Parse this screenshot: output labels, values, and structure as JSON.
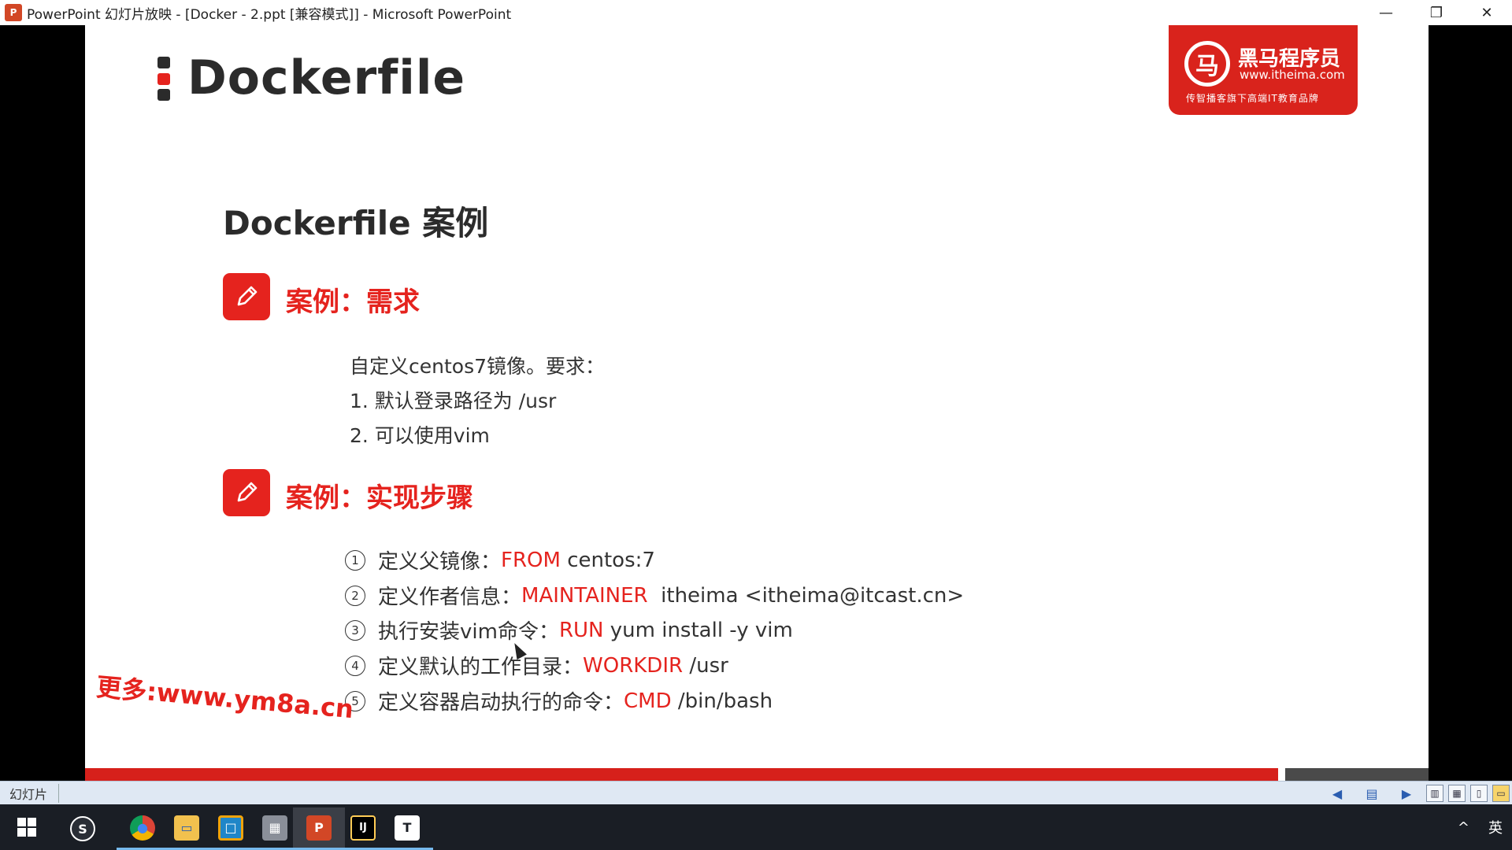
{
  "window": {
    "title": "PowerPoint 幻灯片放映 - [Docker - 2.ppt [兼容模式]] - Microsoft PowerPoint",
    "app_icon": "P",
    "minimize": "—",
    "restore": "❐",
    "close": "✕"
  },
  "slide": {
    "title": "Dockerfile",
    "logo": {
      "name": "黑马程序员",
      "url": "www.itheima.com",
      "slogan": "传智播客旗下高端IT教育品牌",
      "mark": "马"
    },
    "section_title": "Dockerfile 案例",
    "case1": {
      "title": "案例：需求",
      "lines": [
        "自定义centos7镜像。要求：",
        "1. 默认登录路径为 /usr",
        "2. 可以使用vim"
      ]
    },
    "case2": {
      "title": "案例：实现步骤",
      "steps": [
        {
          "num": "1",
          "text": "定义父镜像：",
          "keyword": "FROM",
          "rest": " centos:7"
        },
        {
          "num": "2",
          "text": "定义作者信息：",
          "keyword": "MAINTAINER",
          "rest": "  itheima <itheima@itcast.cn>"
        },
        {
          "num": "3",
          "text": "执行安装vim命令：",
          "keyword": "RUN",
          "rest": " yum install -y vim"
        },
        {
          "num": "4",
          "text": "定义默认的工作目录：",
          "keyword": "WORKDIR",
          "rest": " /usr"
        },
        {
          "num": "5",
          "text": "定义容器启动执行的命令：",
          "keyword": "CMD",
          "rest": " /bin/bash"
        }
      ]
    },
    "watermark": "更多:www.ym8a.cn",
    "colors": {
      "accent": "#e5231e",
      "marker_dark": "#2b2b2b",
      "marker_red": "#e5231e"
    }
  },
  "statusbar": {
    "label": "幻灯片",
    "prev_icon": "arrow-left-icon",
    "notes_icon": "notes-icon",
    "next_icon": "arrow-right-icon"
  },
  "taskbar": {
    "apps": [
      {
        "name": "360-browser",
        "glyph": "S"
      },
      {
        "name": "chrome",
        "glyph": "●"
      },
      {
        "name": "file-explorer",
        "glyph": "▭"
      },
      {
        "name": "vmware",
        "glyph": "□"
      },
      {
        "name": "image-viewer",
        "glyph": "▦"
      },
      {
        "name": "powerpoint",
        "glyph": "P"
      },
      {
        "name": "intellij",
        "glyph": "IJ"
      },
      {
        "name": "typora",
        "glyph": "T"
      }
    ],
    "tray_caret": "^",
    "ime": "英"
  }
}
